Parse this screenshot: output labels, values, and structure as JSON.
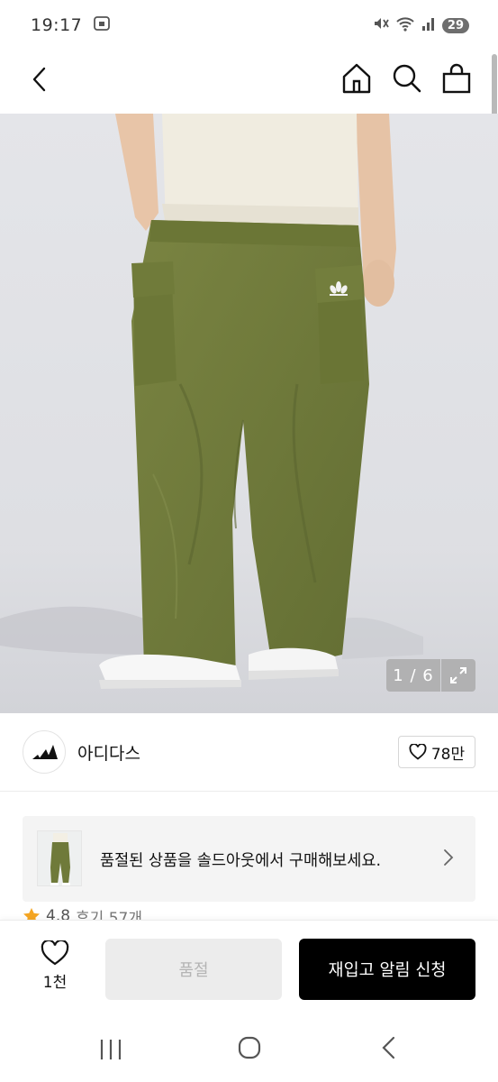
{
  "status_bar": {
    "time": "19:17",
    "battery": "29"
  },
  "product": {
    "image_counter": "1 / 6",
    "brand_name": "아디다스",
    "like_count": "78만",
    "rating": "4.8",
    "review_label": "후기 57개"
  },
  "soldout_banner": {
    "text": "품절된 상품을 솔드아웃에서 구매해보세요."
  },
  "bottom_bar": {
    "wish_count": "1천",
    "soldout_label": "품절",
    "restock_label": "재입고 알림 신청"
  },
  "colors": {
    "accent": "#000000",
    "pants": "#6f7a3a",
    "star": "#f5a623"
  },
  "icons": [
    "back-arrow-icon",
    "home-icon",
    "search-icon",
    "shopping-bag-icon",
    "expand-icon",
    "heart-icon",
    "chevron-right-icon",
    "star-icon",
    "recents-icon",
    "home-circle-icon",
    "back-icon"
  ]
}
